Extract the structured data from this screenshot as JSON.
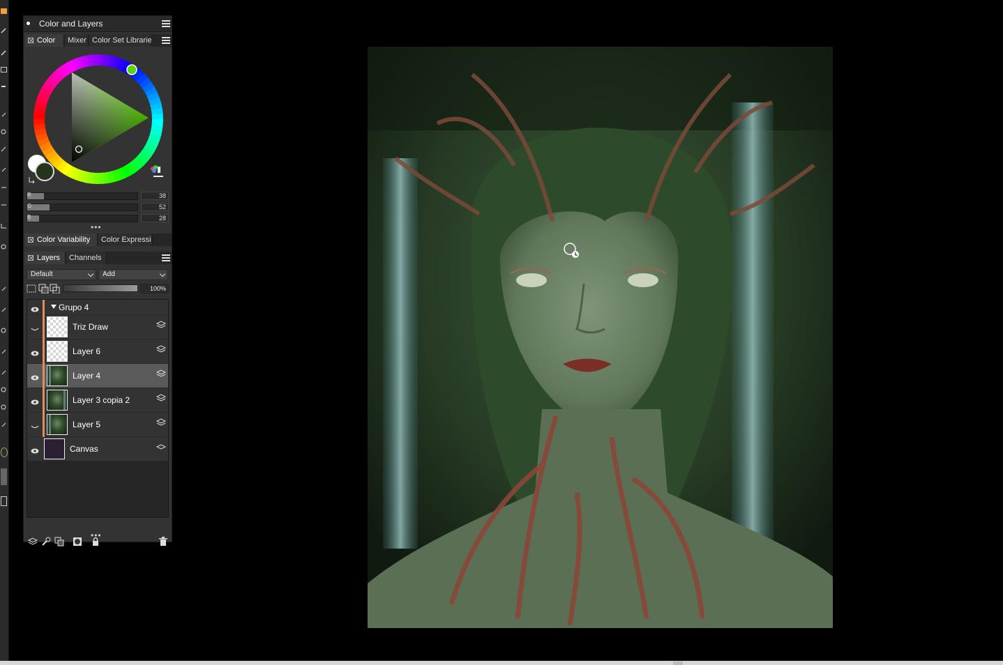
{
  "palette": {
    "title": "Color and Layers",
    "color_tabs": [
      "Color",
      "Mixer",
      "Color Set Libraries"
    ],
    "color_tab_labels": [
      "Color",
      "Mixer",
      "Color Set Librarie"
    ],
    "active_color_tab": "Color",
    "current_color": {
      "r": 38,
      "g": 52,
      "b": 28,
      "hex": "#26341c"
    },
    "secondary_color_hex": "#ffffff",
    "hue_hex": "#5ad700",
    "sliders": [
      {
        "label": "R",
        "value": "38",
        "fraction": 0.149
      },
      {
        "label": "G",
        "value": "52",
        "fraction": 0.204
      },
      {
        "label": "B",
        "value": "28",
        "fraction": 0.11
      }
    ],
    "sub_tabs": [
      "Color Variability",
      "Color Expressi"
    ],
    "layers_tabs": [
      "Layers",
      "Channels"
    ],
    "active_layers_tab": "Layers",
    "blend_preset": "Default",
    "composite_method": "Add",
    "opacity": "100%",
    "opacity_fraction": 1.0,
    "group": {
      "name": "Grupo 4",
      "visible": true,
      "expanded": true
    },
    "layers": [
      {
        "name": "Triz Draw",
        "visible": false,
        "thumb": "transparent",
        "selected": false
      },
      {
        "name": "Layer 6",
        "visible": true,
        "thumb": "transparent",
        "selected": false
      },
      {
        "name": "Layer 4",
        "visible": true,
        "thumb": "painting",
        "selected": true
      },
      {
        "name": "Layer 3 copia 2",
        "visible": true,
        "thumb": "painting",
        "selected": false
      },
      {
        "name": "Layer 5",
        "visible": false,
        "thumb": "painting",
        "selected": false
      }
    ],
    "canvas_layer": {
      "name": "Canvas",
      "visible": true,
      "color": "#2a1f33"
    },
    "bottom_icons": [
      "new-layer-icon",
      "layer-tools-icon",
      "duplicate-layer-icon",
      "mask-icon",
      "lock-icon",
      "trash-icon"
    ]
  },
  "colors": {
    "accent_layer_bar": "#e28e5a",
    "background": "#000000",
    "panel": "#333333"
  }
}
